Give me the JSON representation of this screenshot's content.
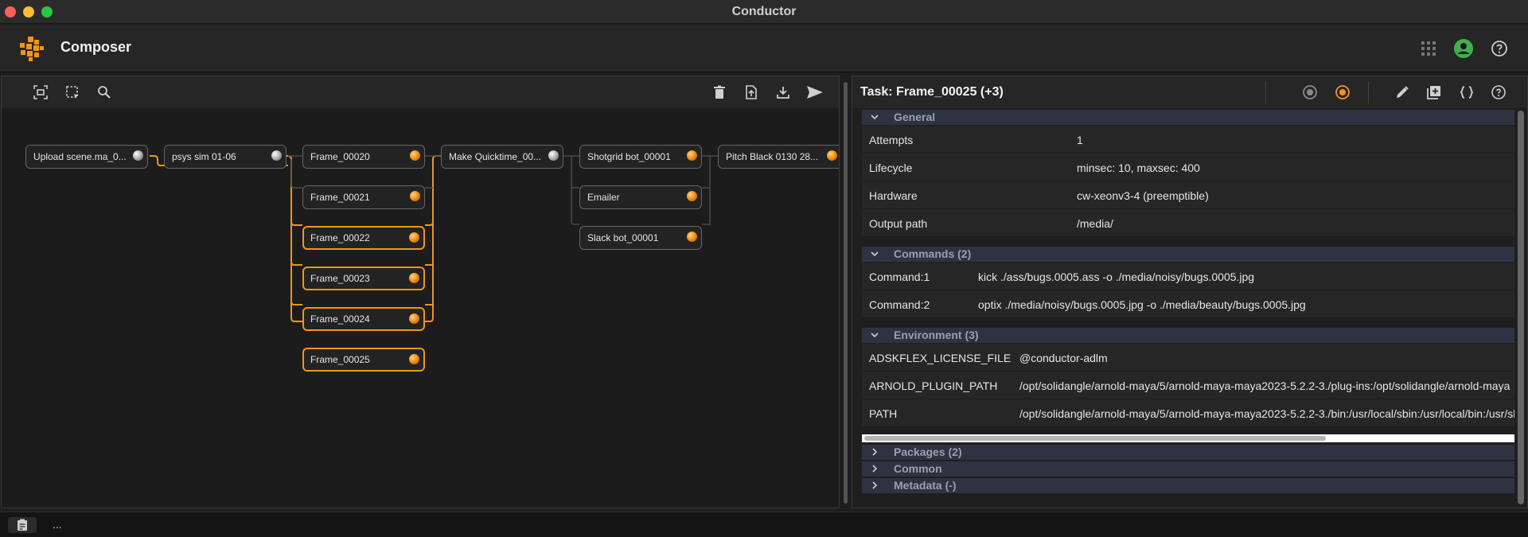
{
  "window": {
    "title": "Conductor"
  },
  "app": {
    "title": "Composer"
  },
  "icons": {
    "logo": "conductor-logo-icon",
    "apps": "grid-apps-icon",
    "account": "account-circle-icon",
    "help": "help-icon",
    "fit": "fit-view-icon",
    "select": "select-region-icon",
    "search": "search-icon",
    "delete": "trash-icon",
    "export": "file-export-icon",
    "download": "download-icon",
    "send": "send-icon"
  },
  "colors": {
    "accent": "#f0951a",
    "account": "#3cb34a",
    "sectionBar": "#2d3342"
  },
  "graph": {
    "nodes": [
      {
        "id": "upload",
        "label": "Upload scene.ma_0...",
        "status": "grey",
        "selected": false
      },
      {
        "id": "psys",
        "label": "psys sim 01-06",
        "status": "grey",
        "selected": false
      },
      {
        "id": "f20",
        "label": "Frame_00020",
        "status": "orange",
        "selected": false
      },
      {
        "id": "f21",
        "label": "Frame_00021",
        "status": "orange",
        "selected": false
      },
      {
        "id": "f22",
        "label": "Frame_00022",
        "status": "orange",
        "selected": true
      },
      {
        "id": "f23",
        "label": "Frame_00023",
        "status": "orange",
        "selected": true
      },
      {
        "id": "f24",
        "label": "Frame_00024",
        "status": "orange",
        "selected": true
      },
      {
        "id": "f25",
        "label": "Frame_00025",
        "status": "orange",
        "selected": true
      },
      {
        "id": "quick",
        "label": "Make Quicktime_00...",
        "status": "grey",
        "selected": false
      },
      {
        "id": "shot",
        "label": "Shotgrid bot_00001",
        "status": "orange",
        "selected": false
      },
      {
        "id": "email",
        "label": "Emailer",
        "status": "orange",
        "selected": false
      },
      {
        "id": "slack",
        "label": "Slack bot_00001",
        "status": "orange",
        "selected": false
      },
      {
        "id": "pitch",
        "label": "Pitch Black 0130 28...",
        "status": "orange",
        "selected": false
      }
    ]
  },
  "panel": {
    "title": "Task: Frame_00025 (+3)",
    "general": {
      "title": "General",
      "rows": [
        {
          "key": "Attempts",
          "value": "1"
        },
        {
          "key": "Lifecycle",
          "value": "minsec: 10, maxsec: 400"
        },
        {
          "key": "Hardware",
          "value": "cw-xeonv3-4 (preemptible)"
        },
        {
          "key": "Output path",
          "value": "/media/"
        }
      ]
    },
    "commands": {
      "title": "Commands (2)",
      "rows": [
        {
          "key": "Command:1",
          "value": "kick ./ass/bugs.0005.ass -o ./media/noisy/bugs.0005.jpg"
        },
        {
          "key": "Command:2",
          "value": "optix ./media/noisy/bugs.0005.jpg -o ./media/beauty/bugs.0005.jpg"
        }
      ]
    },
    "environment": {
      "title": "Environment (3)",
      "rows": [
        {
          "key": "ADSKFLEX_LICENSE_FILE",
          "value": "@conductor-adlm"
        },
        {
          "key": "ARNOLD_PLUGIN_PATH",
          "value": "/opt/solidangle/arnold-maya/5/arnold-maya-maya2023-5.2.2-3./plug-ins:/opt/solidangle/arnold-maya"
        },
        {
          "key": "PATH",
          "value": "/opt/solidangle/arnold-maya/5/arnold-maya-maya2023-5.2.2-3./bin:/usr/local/sbin:/usr/local/bin:/usr/sbin"
        }
      ]
    },
    "collapsed": [
      "Packages (2)",
      "Common",
      "Metadata (-)"
    ]
  },
  "status": {
    "text": "..."
  }
}
